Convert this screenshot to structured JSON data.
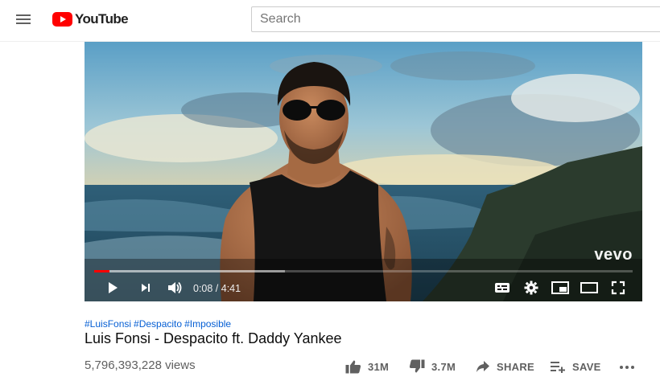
{
  "header": {
    "logo_text": "YouTube",
    "search_placeholder": "Search"
  },
  "player": {
    "watermark": "vevo",
    "time_current": "0:08",
    "time_total": "4:41",
    "time_display": "0:08 / 4:41",
    "progress_fraction": 0.028,
    "buffered_fraction": 0.355
  },
  "video": {
    "hashtags": [
      "#LuisFonsi",
      "#Despacito",
      "#Imposible"
    ],
    "title": "Luis Fonsi - Despacito ft. Daddy Yankee",
    "views": "5,796,393,228 views",
    "likes": "31M",
    "dislikes": "3.7M",
    "share_label": "SHARE",
    "save_label": "SAVE"
  },
  "colors": {
    "brand_red": "#ff0000",
    "link_blue": "#065fd4",
    "text_secondary": "#606060"
  },
  "icons": [
    "menu-icon",
    "youtube-logo-icon",
    "play-icon",
    "next-icon",
    "volume-icon",
    "subtitles-icon",
    "settings-icon",
    "miniplayer-icon",
    "theater-icon",
    "fullscreen-icon",
    "like-icon",
    "dislike-icon",
    "share-icon",
    "save-icon",
    "more-icon"
  ]
}
